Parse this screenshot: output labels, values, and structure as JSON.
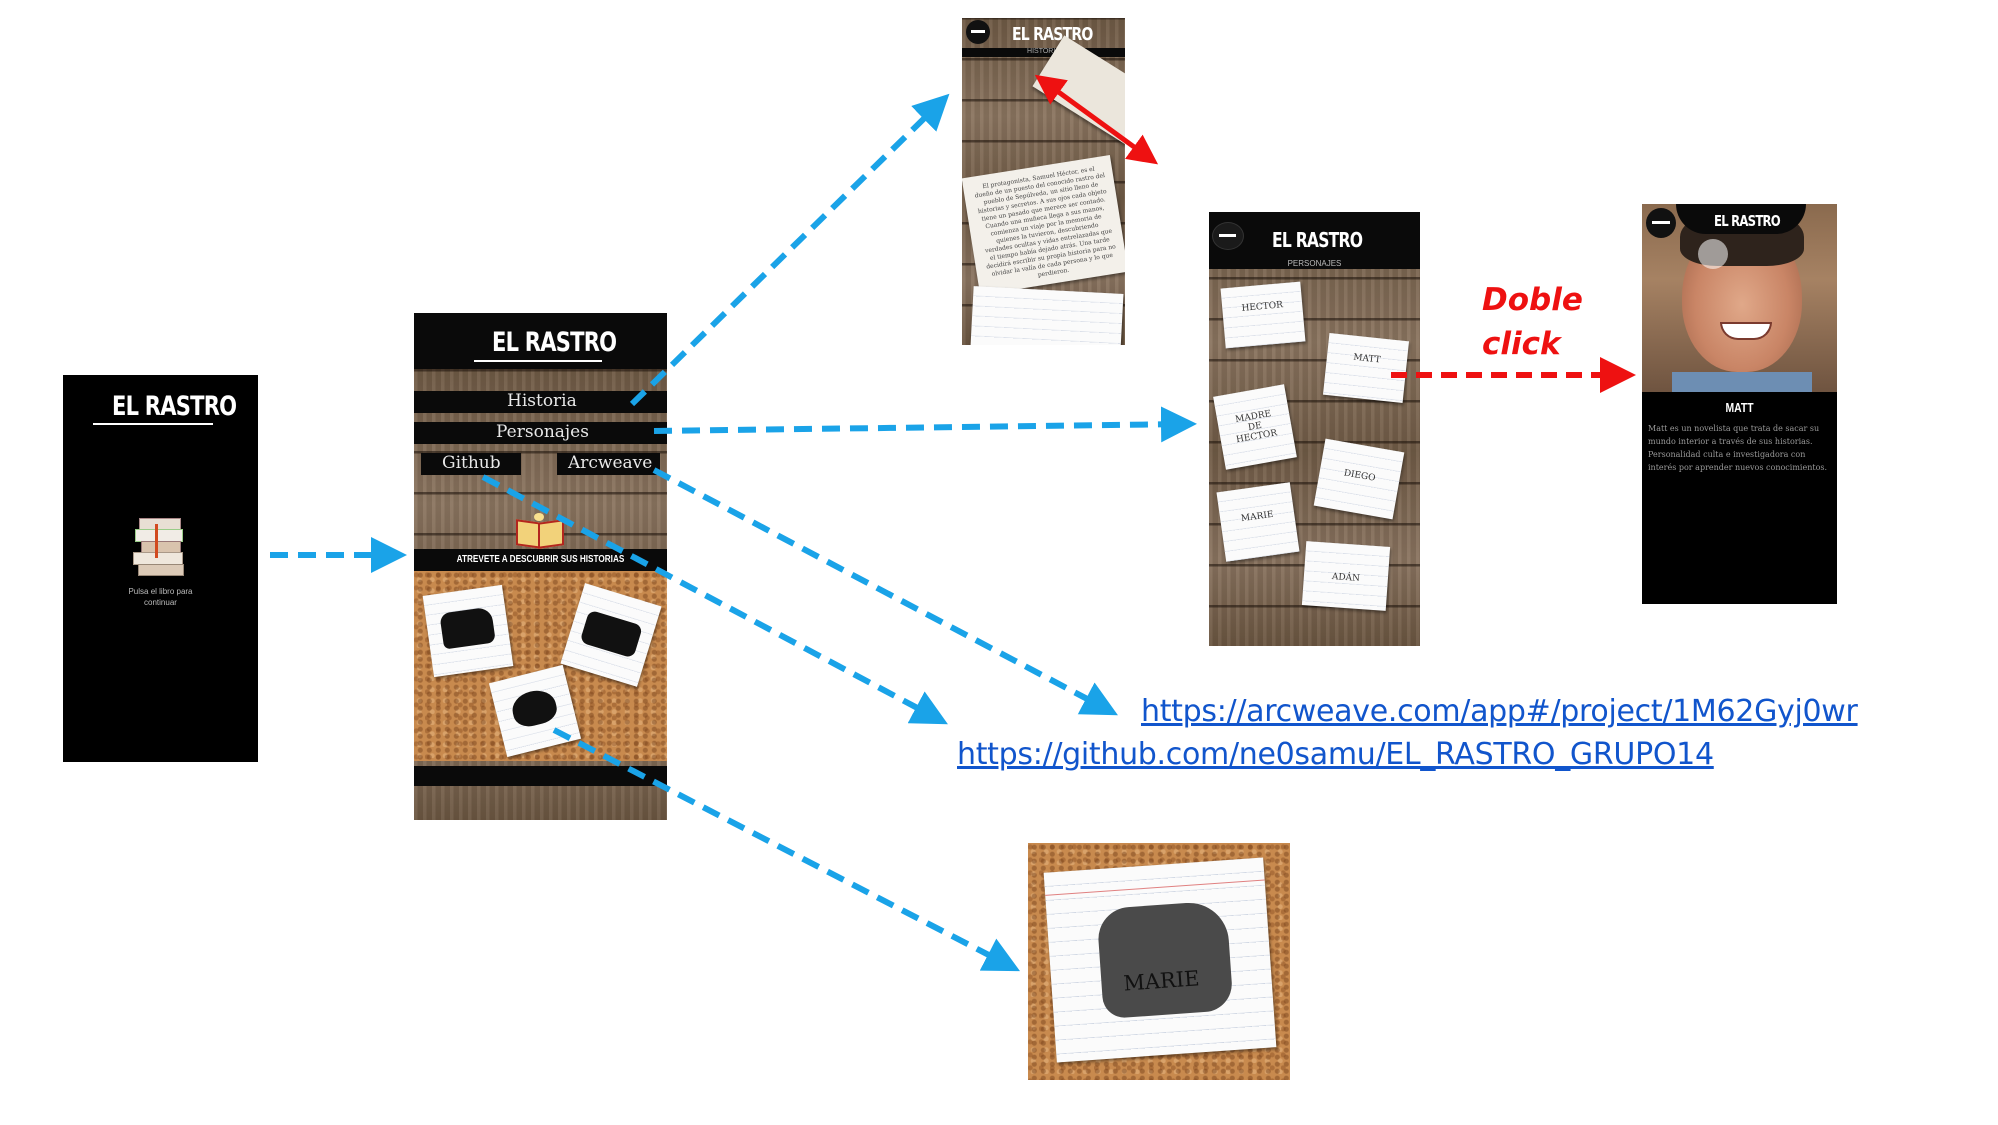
{
  "app": {
    "logo": "EL RASTRO"
  },
  "splash": {
    "prompt": "Pulsa el libro para continuar"
  },
  "main_menu": {
    "items": [
      "Historia",
      "Personajes",
      "Github",
      "Arcweave"
    ],
    "banner": "ATREVETE A DESCUBRIR SUS HISTORIAS"
  },
  "historia_screen": {
    "subtitle": "HISTORIA",
    "story": "El protagonista, Samuel Héctor, es el dueño de un puesto del conocido rastro del pueblo de Sepúlveda, un sitio lleno de historias y secretos. A sus ojos cada objeto tiene un pasado que merece ser contado. Cuando una muñeca llega a sus manos, comienza un viaje por la memoria de quienes la tuvieron, descubriendo verdades ocultas y vidas entrelazadas que el tiempo había dejado atrás. Una tarde decidirá escribir su propia historia para no olvidar la valía de cada persona y lo que perdieron."
  },
  "personajes_screen": {
    "subtitle": "PERSONAJES",
    "cards": [
      "HECTOR",
      "MATT",
      "MADRE DE HECTOR",
      "DIEGO",
      "MARIE",
      "ADÁN"
    ]
  },
  "matt_screen": {
    "name": "MATT",
    "bio": "Matt es un novelista que trata de sacar su mundo interior a través de sus historias. Personalidad culta e investigadora con interés por aprender nuevos conocimientos."
  },
  "annotations": {
    "doble_line1": "Doble",
    "doble_line2": "click"
  },
  "links": {
    "arcweave": "https://arcweave.com/app#/project/1M62Gyj0wr",
    "github": "https://github.com/ne0samu/EL_RASTRO_GRUPO14"
  },
  "zoom_card": {
    "label": "MARIE"
  },
  "colors": {
    "flow_arrow": "#1aa3e8",
    "red_arrow": "#ee1111",
    "link": "#1155cc"
  }
}
